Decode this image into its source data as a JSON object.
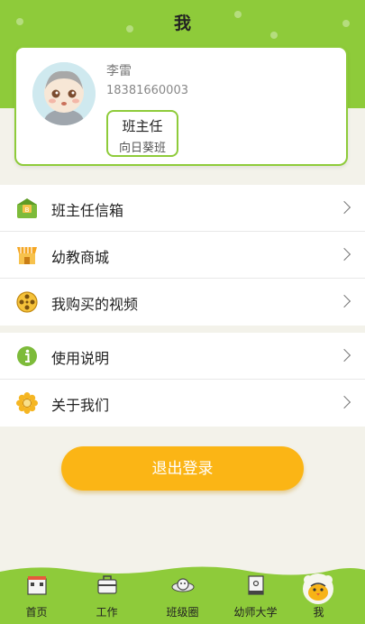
{
  "header": {
    "title": "我"
  },
  "profile": {
    "name": "李雷",
    "phone": "18381660003",
    "role": "班主任",
    "class": "向日葵班"
  },
  "menu_group1": [
    {
      "label": "班主任信箱",
      "icon": "mailbox-icon"
    },
    {
      "label": "幼教商城",
      "icon": "shop-icon"
    },
    {
      "label": "我购买的视频",
      "icon": "video-reel-icon"
    }
  ],
  "menu_group2": [
    {
      "label": "使用说明",
      "icon": "info-icon"
    },
    {
      "label": "关于我们",
      "icon": "flower-icon"
    }
  ],
  "logout_label": "退出登录",
  "tabs": [
    {
      "label": "首页",
      "icon": "home-icon"
    },
    {
      "label": "工作",
      "icon": "briefcase-icon"
    },
    {
      "label": "班级圈",
      "icon": "planet-icon"
    },
    {
      "label": "幼师大学",
      "icon": "book-icon"
    },
    {
      "label": "我",
      "icon": "chick-icon",
      "active": true
    }
  ],
  "colors": {
    "green": "#8ecb3a",
    "orange": "#fbb515",
    "background": "#f3f2ea"
  }
}
